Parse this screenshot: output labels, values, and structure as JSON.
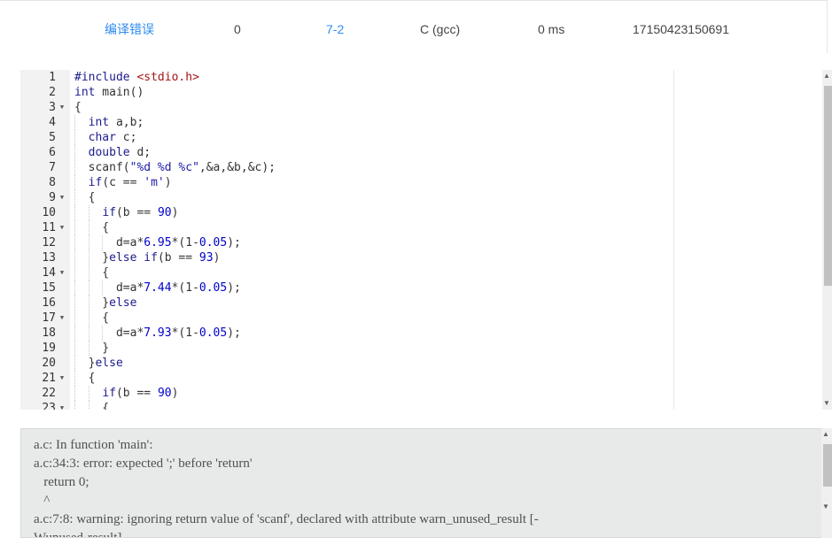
{
  "submission": {
    "status": "编译错误",
    "score": "0",
    "problem": "7-2",
    "language": "C (gcc)",
    "time": "0 ms",
    "user_id": "17150423150691"
  },
  "code_lines": [
    {
      "n": "1",
      "fold": false,
      "indent": 0,
      "tokens": [
        [
          "pre",
          "#include "
        ],
        [
          "inc",
          "<stdio.h>"
        ]
      ]
    },
    {
      "n": "2",
      "fold": false,
      "indent": 0,
      "tokens": [
        [
          "kw",
          "int"
        ],
        [
          "t",
          " main()"
        ]
      ]
    },
    {
      "n": "3",
      "fold": true,
      "indent": 0,
      "tokens": [
        [
          "t",
          "{"
        ]
      ]
    },
    {
      "n": "4",
      "fold": false,
      "indent": 1,
      "tokens": [
        [
          "t",
          "  "
        ],
        [
          "kw",
          "int"
        ],
        [
          "t",
          " a,b;"
        ]
      ]
    },
    {
      "n": "5",
      "fold": false,
      "indent": 1,
      "tokens": [
        [
          "t",
          "  "
        ],
        [
          "kw",
          "char"
        ],
        [
          "t",
          " c;"
        ]
      ]
    },
    {
      "n": "6",
      "fold": false,
      "indent": 1,
      "tokens": [
        [
          "t",
          "  "
        ],
        [
          "kw",
          "double"
        ],
        [
          "t",
          " d;"
        ]
      ]
    },
    {
      "n": "7",
      "fold": false,
      "indent": 1,
      "tokens": [
        [
          "t",
          "  scanf("
        ],
        [
          "str",
          "\"%d %d %c\""
        ],
        [
          "t",
          ",&a,&b,&c);"
        ]
      ]
    },
    {
      "n": "8",
      "fold": false,
      "indent": 1,
      "tokens": [
        [
          "t",
          "  "
        ],
        [
          "kw",
          "if"
        ],
        [
          "t",
          "(c == "
        ],
        [
          "str",
          "'m'"
        ],
        [
          "t",
          ")"
        ]
      ]
    },
    {
      "n": "9",
      "fold": true,
      "indent": 1,
      "tokens": [
        [
          "t",
          "  {"
        ]
      ]
    },
    {
      "n": "10",
      "fold": false,
      "indent": 2,
      "tokens": [
        [
          "t",
          "    "
        ],
        [
          "kw",
          "if"
        ],
        [
          "t",
          "(b == "
        ],
        [
          "num",
          "90"
        ],
        [
          "t",
          ")"
        ]
      ]
    },
    {
      "n": "11",
      "fold": true,
      "indent": 2,
      "tokens": [
        [
          "t",
          "    {"
        ]
      ]
    },
    {
      "n": "12",
      "fold": false,
      "indent": 3,
      "tokens": [
        [
          "t",
          "      d=a*"
        ],
        [
          "num",
          "6.95"
        ],
        [
          "t",
          "*(1-"
        ],
        [
          "num",
          "0.05"
        ],
        [
          "t",
          ");"
        ]
      ]
    },
    {
      "n": "13",
      "fold": false,
      "indent": 2,
      "tokens": [
        [
          "t",
          "    }"
        ],
        [
          "kw",
          "else"
        ],
        [
          "t",
          " "
        ],
        [
          "kw",
          "if"
        ],
        [
          "t",
          "(b == "
        ],
        [
          "num",
          "93"
        ],
        [
          "t",
          ")"
        ]
      ]
    },
    {
      "n": "14",
      "fold": true,
      "indent": 2,
      "tokens": [
        [
          "t",
          "    {"
        ]
      ]
    },
    {
      "n": "15",
      "fold": false,
      "indent": 3,
      "tokens": [
        [
          "t",
          "      d=a*"
        ],
        [
          "num",
          "7.44"
        ],
        [
          "t",
          "*(1-"
        ],
        [
          "num",
          "0.05"
        ],
        [
          "t",
          ");"
        ]
      ]
    },
    {
      "n": "16",
      "fold": false,
      "indent": 2,
      "tokens": [
        [
          "t",
          "    }"
        ],
        [
          "kw",
          "else"
        ]
      ]
    },
    {
      "n": "17",
      "fold": true,
      "indent": 2,
      "tokens": [
        [
          "t",
          "    {"
        ]
      ]
    },
    {
      "n": "18",
      "fold": false,
      "indent": 3,
      "tokens": [
        [
          "t",
          "      d=a*"
        ],
        [
          "num",
          "7.93"
        ],
        [
          "t",
          "*(1-"
        ],
        [
          "num",
          "0.05"
        ],
        [
          "t",
          ");"
        ]
      ]
    },
    {
      "n": "19",
      "fold": false,
      "indent": 2,
      "tokens": [
        [
          "t",
          "    }"
        ]
      ]
    },
    {
      "n": "20",
      "fold": false,
      "indent": 1,
      "tokens": [
        [
          "t",
          "  }"
        ],
        [
          "kw",
          "else"
        ]
      ]
    },
    {
      "n": "21",
      "fold": true,
      "indent": 1,
      "tokens": [
        [
          "t",
          "  {"
        ]
      ]
    },
    {
      "n": "22",
      "fold": false,
      "indent": 2,
      "tokens": [
        [
          "t",
          "    "
        ],
        [
          "kw",
          "if"
        ],
        [
          "t",
          "(b == "
        ],
        [
          "num",
          "90"
        ],
        [
          "t",
          ")"
        ]
      ]
    },
    {
      "n": "23",
      "fold": true,
      "indent": 2,
      "tokens": [
        [
          "t",
          "    {"
        ]
      ]
    }
  ],
  "compiler_output": "a.c: In function 'main':\na.c:34:3: error: expected ';' before 'return'\n   return 0;\n   ^\na.c:7:8: warning: ignoring return value of 'scanf', declared with attribute warn_unused_result [-\nWunused-result]",
  "colors": {
    "link": "#2d8cf0",
    "keyword": "#1c1c8c",
    "number": "#0000cd",
    "gutter": "#f2f2f2",
    "console_bg": "#e8eaea"
  },
  "icons": {
    "fold": "fold-arrow-icon",
    "scroll_up": "scroll-up-icon",
    "scroll_down": "scroll-down-icon"
  }
}
